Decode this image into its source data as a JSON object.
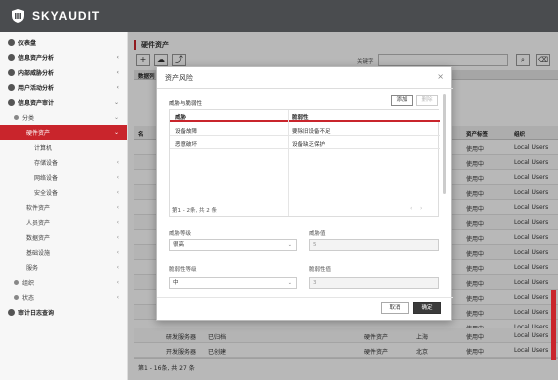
{
  "app": {
    "name": "SKYAUDIT"
  },
  "sidebar": {
    "items": [
      {
        "label": "仪表盘"
      },
      {
        "label": "信息资产分析"
      },
      {
        "label": "内部威胁分析"
      },
      {
        "label": "用户活动分析"
      },
      {
        "label": "信息资产审计"
      },
      {
        "label": "分类"
      },
      {
        "label": "硬件资产"
      },
      {
        "label": "计算机"
      },
      {
        "label": "存储设备"
      },
      {
        "label": "网络设备"
      },
      {
        "label": "安全设备"
      },
      {
        "label": "软件资产"
      },
      {
        "label": "人员资产"
      },
      {
        "label": "数据资产"
      },
      {
        "label": "基础设施"
      },
      {
        "label": "服务"
      },
      {
        "label": "组织"
      },
      {
        "label": "状态"
      },
      {
        "label": "审计日志查询"
      }
    ]
  },
  "main": {
    "title": "硬件资产",
    "search_label": "关键字",
    "col_header_partial": "数据列",
    "col_prefix": "名",
    "columns": {
      "asset_tag": "资产标签",
      "org": "组织"
    },
    "rows": [
      {
        "tag": "使用中",
        "org": "Local Users"
      },
      {
        "tag": "使用中",
        "org": "Local Users"
      },
      {
        "tag": "使用中",
        "org": "Local Users"
      },
      {
        "tag": "使用中",
        "org": "Local Users"
      },
      {
        "tag": "使用中",
        "org": "Local Users"
      },
      {
        "tag": "使用中",
        "org": "Local Users"
      },
      {
        "tag": "使用中",
        "org": "Local Users"
      },
      {
        "tag": "使用中",
        "org": "Local Users"
      },
      {
        "tag": "使用中",
        "org": "Local Users"
      },
      {
        "tag": "使用中",
        "org": "Local Users"
      },
      {
        "tag": "使用中",
        "org": "Local Users"
      },
      {
        "tag": "使用中",
        "org": "Local Users"
      },
      {
        "tag": "使用中",
        "org": "Local Users"
      },
      {
        "tag": "使用中",
        "org": "Local Users"
      },
      {
        "tag": "使用中",
        "org": "Local Users"
      }
    ],
    "bottom_rows": [
      {
        "name": "研发服务器",
        "status": "已归档",
        "type": "硬件资产",
        "loc": "上海",
        "tag": "使用中",
        "org": "Local Users"
      },
      {
        "name": "开发服务器",
        "status": "已创建",
        "type": "硬件资产",
        "loc": "北京",
        "tag": "使用中",
        "org": "Local Users"
      }
    ],
    "footer": "第1 - 16条, 共 27 条"
  },
  "modal": {
    "title": "资产风险",
    "section_label": "威胁与脆弱性",
    "add_button": "添加",
    "delete_button": "删除",
    "table": {
      "headers": [
        "威胁",
        "脆弱性"
      ],
      "rows": [
        [
          "设备故障",
          "要除旧设备不足"
        ],
        [
          "恶意破坏",
          "设备缺乏保护"
        ]
      ]
    },
    "pager": "第1 - 2条, 共 2 条",
    "fields": {
      "threat_level_label": "威胁等级",
      "threat_level_value": "很高",
      "threat_value_label": "威胁值",
      "threat_value": "5",
      "vuln_level_label": "脆弱性等级",
      "vuln_level_value": "中",
      "vuln_value_label": "脆弱性值",
      "vuln_value": "3"
    },
    "cancel_button": "取消",
    "ok_button": "确定"
  },
  "colors": {
    "accent": "#c9252c",
    "topbar": "#4a4c4f"
  }
}
